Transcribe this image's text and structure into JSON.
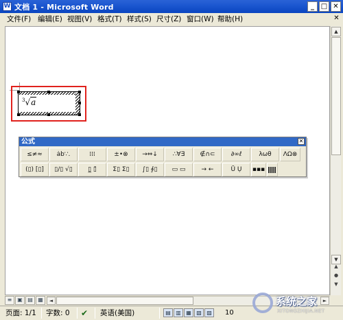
{
  "window": {
    "icon": "word-doc-icon",
    "title": "文档 1 - Microsoft Word",
    "controls": {
      "minimize": "_",
      "maximize": "□",
      "close": "✕"
    }
  },
  "menubar": {
    "items": [
      "文件(F)",
      "编辑(E)",
      "视图(V)",
      "格式(T)",
      "样式(S)",
      "尺寸(Z)",
      "窗口(W)",
      "帮助(H)"
    ],
    "close_glyph": "✕"
  },
  "document": {
    "equation": {
      "root_index": "3",
      "radicand": "a",
      "description": "cube-root-of-a"
    }
  },
  "equation_toolbar": {
    "title": "公式",
    "close_glyph": "✕",
    "row1": [
      "≤≠≈",
      "ȧb∵.",
      "⁞⁞⁞",
      "±•⊗",
      "→⇔↓",
      "∴∀∃",
      "∉∩⊂",
      "∂∞ℓ",
      "λωθ",
      "ΛΩ⊗"
    ],
    "row2": [
      "(▯) [▯]",
      "▯/▯ √▯",
      "▯̲ ▯̄",
      "Σ▯ Σ▯",
      "∫▯ ∮▯",
      "▭ ▭",
      "→ ←",
      "Ū Ụ",
      "▪▪▪",
      ""
    ]
  },
  "scrollbars": {
    "up": "▲",
    "down": "▼",
    "left": "◄",
    "right": "►",
    "prev_page": "▲",
    "select_browse": "●",
    "next_page": "▼"
  },
  "view_buttons": [
    "≡",
    "▣",
    "▤",
    "▦"
  ],
  "statusbar": {
    "page": "页面: 1/1",
    "words": "字数: 0",
    "language": "英语(美国)",
    "zoom_fragment": "10"
  },
  "watermark": {
    "text": "系统之家",
    "url": "XITONGZHIJIA.NET"
  },
  "colors": {
    "titlebar": "#0a45c0",
    "highlight_border": "#e0211c",
    "toolbar_title": "#3169c6"
  }
}
